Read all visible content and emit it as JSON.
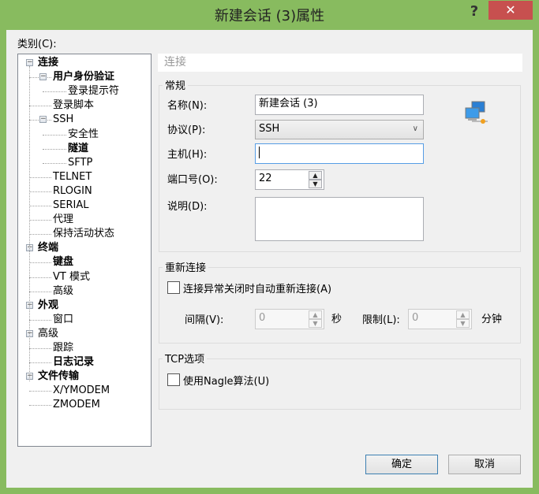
{
  "window": {
    "title": "新建会话 (3)属性",
    "help": "?",
    "close": "✕",
    "accent": "#88bb5f"
  },
  "category_label": "类别(C):",
  "tree": [
    {
      "label": "连接",
      "level": 0,
      "bold": true,
      "expander": true
    },
    {
      "label": "用户身份验证",
      "level": 1,
      "bold": true,
      "expander": true
    },
    {
      "label": "登录提示符",
      "level": 2,
      "bold": false
    },
    {
      "label": "登录脚本",
      "level": 1,
      "bold": false
    },
    {
      "label": "SSH",
      "level": 1,
      "bold": false,
      "expander": true
    },
    {
      "label": "安全性",
      "level": 2,
      "bold": false
    },
    {
      "label": "隧道",
      "level": 2,
      "bold": true
    },
    {
      "label": "SFTP",
      "level": 2,
      "bold": false
    },
    {
      "label": "TELNET",
      "level": 1,
      "bold": false
    },
    {
      "label": "RLOGIN",
      "level": 1,
      "bold": false
    },
    {
      "label": "SERIAL",
      "level": 1,
      "bold": false
    },
    {
      "label": "代理",
      "level": 1,
      "bold": false
    },
    {
      "label": "保持活动状态",
      "level": 1,
      "bold": false
    },
    {
      "label": "终端",
      "level": 0,
      "bold": true,
      "expander": true
    },
    {
      "label": "键盘",
      "level": 1,
      "bold": true
    },
    {
      "label": "VT 模式",
      "level": 1,
      "bold": false
    },
    {
      "label": "高级",
      "level": 1,
      "bold": false
    },
    {
      "label": "外观",
      "level": 0,
      "bold": true,
      "expander": true
    },
    {
      "label": "窗口",
      "level": 1,
      "bold": false
    },
    {
      "label": "高级",
      "level": 0,
      "bold": false,
      "expander": true
    },
    {
      "label": "跟踪",
      "level": 1,
      "bold": false
    },
    {
      "label": "日志记录",
      "level": 1,
      "bold": true
    },
    {
      "label": "文件传输",
      "level": 0,
      "bold": true,
      "expander": true
    },
    {
      "label": "X/YMODEM",
      "level": 1,
      "bold": false
    },
    {
      "label": "ZMODEM",
      "level": 1,
      "bold": false
    }
  ],
  "panel": {
    "header": "连接",
    "general": {
      "title": "常规",
      "name_label": "名称(N):",
      "name_value": "新建会话 (3)",
      "protocol_label": "协议(P):",
      "protocol_value": "SSH",
      "host_label": "主机(H):",
      "host_value": "",
      "port_label": "端口号(O):",
      "port_value": "22",
      "desc_label": "说明(D):",
      "desc_value": ""
    },
    "reconnect": {
      "title": "重新连接",
      "checkbox_label": "连接异常关闭时自动重新连接(A)",
      "checked": false,
      "interval_label": "间隔(V):",
      "interval_value": "0",
      "interval_unit": "秒",
      "limit_label": "限制(L):",
      "limit_value": "0",
      "limit_unit": "分钟"
    },
    "tcp": {
      "title": "TCP选项",
      "checkbox_label": "使用Nagle算法(U)",
      "checked": false
    }
  },
  "buttons": {
    "ok": "确定",
    "cancel": "取消"
  }
}
